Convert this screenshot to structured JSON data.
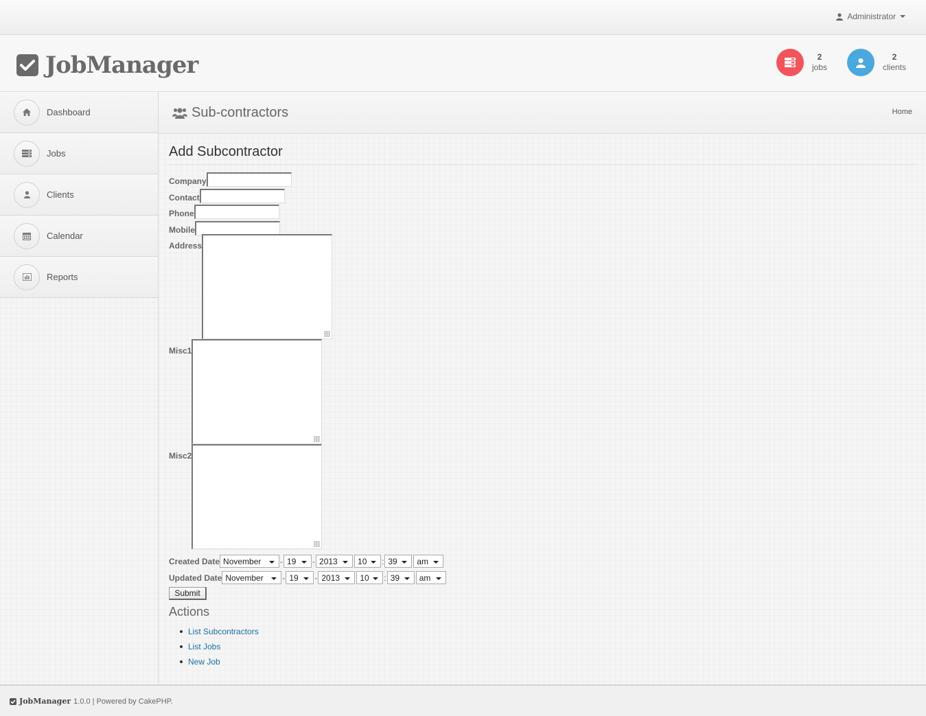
{
  "topbar": {
    "user_label": "Administrator"
  },
  "header": {
    "logo_text": "JobManager",
    "stats": [
      {
        "count": "2",
        "label": "jobs",
        "color": "#f2545b"
      },
      {
        "count": "2",
        "label": "clients",
        "color": "#4aa8dd"
      }
    ]
  },
  "sidebar": {
    "items": [
      {
        "label": "Dashboard",
        "icon": "home-icon"
      },
      {
        "label": "Jobs",
        "icon": "jobs-icon"
      },
      {
        "label": "Clients",
        "icon": "user-icon"
      },
      {
        "label": "Calendar",
        "icon": "calendar-icon"
      },
      {
        "label": "Reports",
        "icon": "chart-icon"
      }
    ]
  },
  "content_header": {
    "title": "Sub-contractors",
    "breadcrumb": "Home"
  },
  "form": {
    "title": "Add Subcontractor",
    "fields": {
      "company": {
        "label": "Company",
        "value": ""
      },
      "contact": {
        "label": "Contact",
        "value": ""
      },
      "phone": {
        "label": "Phone",
        "value": ""
      },
      "mobile": {
        "label": "Mobile",
        "value": ""
      },
      "address": {
        "label": "Address",
        "value": ""
      },
      "misc1": {
        "label": "Misc1",
        "value": ""
      },
      "misc2": {
        "label": "Misc2",
        "value": ""
      }
    },
    "created": {
      "label": "Created Date",
      "month": "November",
      "day": "19",
      "year": "2013",
      "hour": "10",
      "minute": "39",
      "meridian": "am"
    },
    "updated": {
      "label": "Updated Date",
      "month": "November",
      "day": "19",
      "year": "2013",
      "hour": "10",
      "minute": "39",
      "meridian": "am"
    },
    "submit_label": "Submit"
  },
  "actions": {
    "title": "Actions",
    "links": [
      "List Subcontractors",
      "List Jobs",
      "New Job"
    ]
  },
  "footer": {
    "logo_text": "JobManager",
    "text": "1.0.0 | Powered by CakePHP."
  }
}
